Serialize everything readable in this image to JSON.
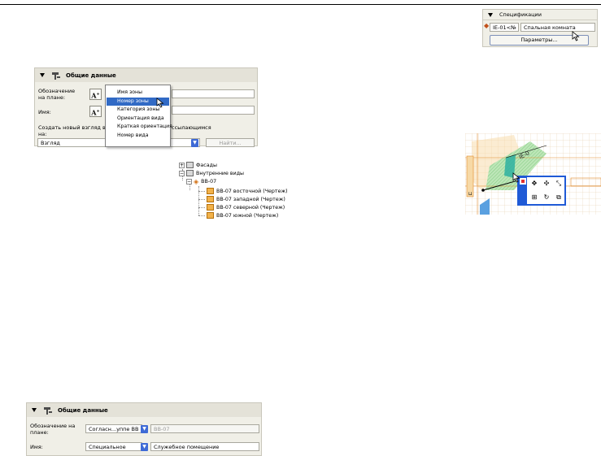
{
  "panel1": {
    "title": "Общие данные",
    "label_designation": "Обозначение на плане:",
    "label_name": "Имя:",
    "label_create_view": "Создать новый взгляд вну",
    "label_create_view_tail": "на:",
    "label_referencing": "ссылающимся",
    "view_select_value": "Взгляд",
    "find_button": "Найти...",
    "dropdown_items": [
      "Имя зоны",
      "Номер зоны",
      "Категория зоны",
      "Ориентация вида",
      "Краткая ориентация",
      "Номер вида"
    ],
    "dropdown_selected": "Номер зоны",
    "a_button": "A"
  },
  "tree": {
    "facades": "Фасады",
    "interior_views": "Внутренние виды",
    "group": "ВВ-07",
    "items": [
      "ВВ-07 восточной (Чертеж)",
      "ВВ-07 западной (Чертеж)",
      "ВВ-07 северной (Чертеж)",
      "ВВ-07 южной (Чертеж)"
    ],
    "toggle_minus": "−",
    "toggle_plus": "+"
  },
  "spec": {
    "title": "Спецификации",
    "id_value": "IE-01<№",
    "room_value": "Спальная комната",
    "params_button": "Параметры..."
  },
  "cad": {
    "tag_label": "IE-0"
  },
  "panel2": {
    "title": "Общие данные",
    "label_designation": "Обозначение на плане:",
    "label_name": "Имя:",
    "designation_select": "Согласн...уппе ВВ",
    "designation_value": "ВВ-07",
    "name_select": "Специальное",
    "name_value": "Служебное помещение"
  },
  "colors": {
    "selection": "#316ac5",
    "panel_bg": "#f0efe7",
    "cad_green": "#7ed27a",
    "popup_border": "#1f5ad6"
  }
}
